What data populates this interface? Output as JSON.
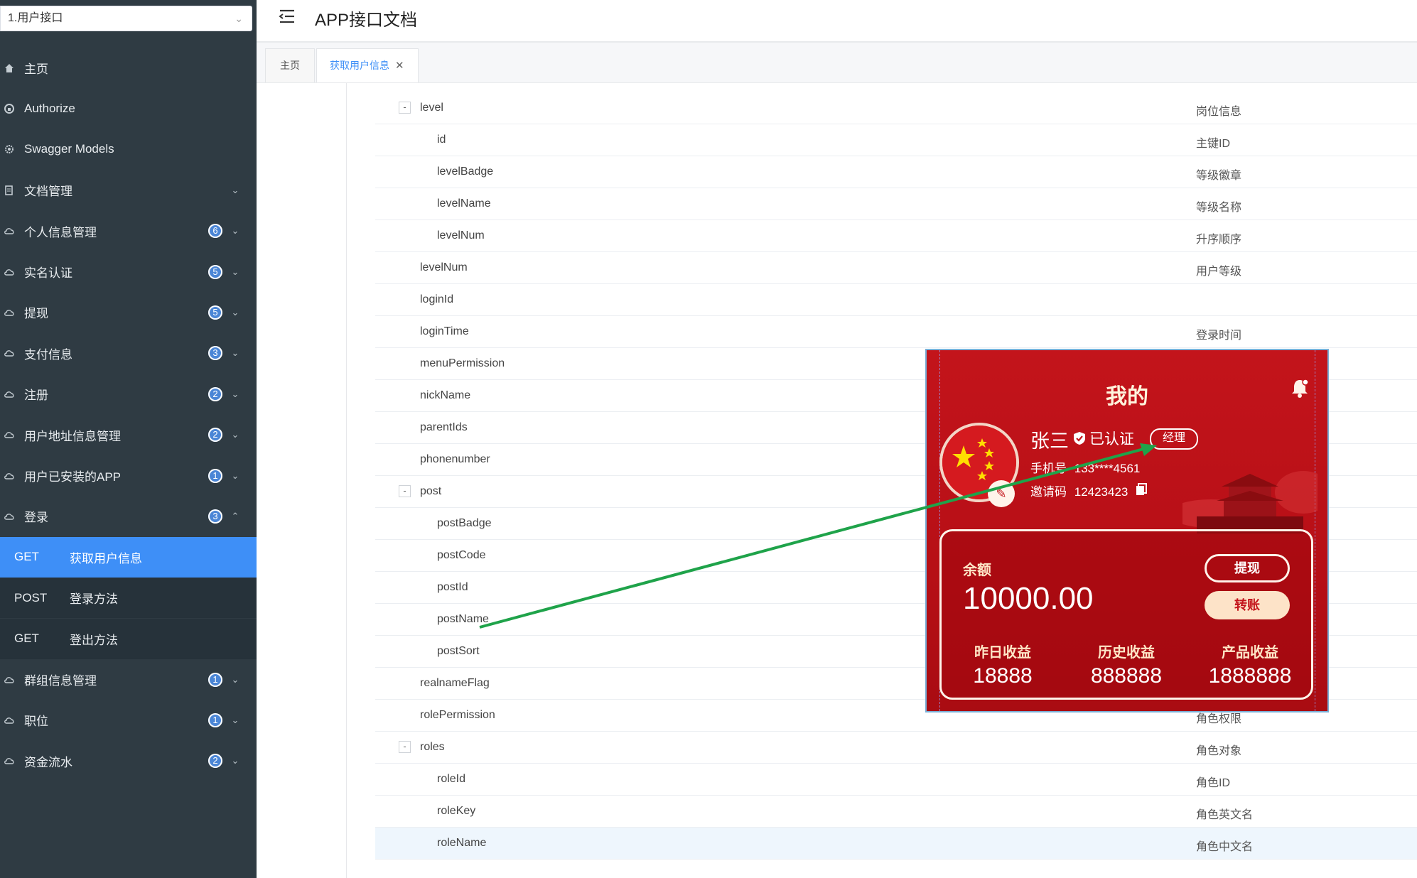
{
  "sidebar": {
    "select": "1.用户接口",
    "items": [
      {
        "label": "主页",
        "icon": "home-icon"
      },
      {
        "label": "Authorize",
        "icon": "lock-icon"
      },
      {
        "label": "Swagger Models",
        "icon": "gear-icon"
      },
      {
        "label": "文档管理",
        "icon": "document-icon"
      },
      {
        "label": "个人信息管理",
        "icon": "cloud-icon",
        "badge": "6"
      },
      {
        "label": "实名认证",
        "icon": "cloud-icon",
        "badge": "5"
      },
      {
        "label": "提现",
        "icon": "cloud-icon",
        "badge": "5"
      },
      {
        "label": "支付信息",
        "icon": "cloud-icon",
        "badge": "3"
      },
      {
        "label": "注册",
        "icon": "cloud-icon",
        "badge": "2"
      },
      {
        "label": "用户地址信息管理",
        "icon": "cloud-icon",
        "badge": "2"
      },
      {
        "label": "用户已安装的APP",
        "icon": "cloud-icon",
        "badge": "1"
      },
      {
        "label": "登录",
        "icon": "cloud-icon",
        "badge": "3"
      }
    ],
    "sub_items": [
      {
        "method": "GET",
        "label": "获取用户信息",
        "active": true
      },
      {
        "method": "POST",
        "label": "登录方法"
      },
      {
        "method": "GET",
        "label": "登出方法"
      }
    ],
    "items_after": [
      {
        "label": "群组信息管理",
        "icon": "cloud-icon",
        "badge": "1"
      },
      {
        "label": "职位",
        "icon": "cloud-icon",
        "badge": "1"
      },
      {
        "label": "资金流水",
        "icon": "cloud-icon",
        "badge": "2"
      }
    ]
  },
  "header": {
    "title": "APP接口文档"
  },
  "tabs": [
    {
      "label": "主页"
    },
    {
      "label": "获取用户信息",
      "active": true
    }
  ],
  "rows": [
    {
      "name": "level",
      "desc": "岗位信息",
      "toggle": "-",
      "indent": 0
    },
    {
      "name": "id",
      "desc": "主键ID",
      "indent": 1
    },
    {
      "name": "levelBadge",
      "desc": "等级徽章",
      "indent": 1
    },
    {
      "name": "levelName",
      "desc": "等级名称",
      "indent": 1
    },
    {
      "name": "levelNum",
      "desc": "升序顺序",
      "indent": 1
    },
    {
      "name": "levelNum",
      "desc": "用户等级",
      "indent": 0
    },
    {
      "name": "loginId",
      "desc": "",
      "indent": 0
    },
    {
      "name": "loginTime",
      "desc": "登录时间",
      "indent": 0
    },
    {
      "name": "menuPermission",
      "desc": "",
      "indent": 0
    },
    {
      "name": "nickName",
      "desc": "",
      "indent": 0
    },
    {
      "name": "parentIds",
      "desc": "",
      "indent": 0
    },
    {
      "name": "phonenumber",
      "desc": "",
      "indent": 0
    },
    {
      "name": "post",
      "desc": "",
      "toggle": "-",
      "indent": 0
    },
    {
      "name": "postBadge",
      "desc": "",
      "indent": 1
    },
    {
      "name": "postCode",
      "desc": "",
      "indent": 1
    },
    {
      "name": "postId",
      "desc": "",
      "indent": 1
    },
    {
      "name": "postName",
      "desc": "",
      "indent": 1
    },
    {
      "name": "postSort",
      "desc": "",
      "indent": 1
    },
    {
      "name": "realnameFlag",
      "desc": "",
      "indent": 0
    },
    {
      "name": "rolePermission",
      "desc": "角色权限",
      "indent": 0
    },
    {
      "name": "roles",
      "desc": "角色对象",
      "toggle": "-",
      "indent": 0
    },
    {
      "name": "roleId",
      "desc": "角色ID",
      "indent": 1
    },
    {
      "name": "roleKey",
      "desc": "角色英文名",
      "indent": 1
    },
    {
      "name": "roleName",
      "desc": "角色中文名",
      "indent": 1,
      "highlight": true
    }
  ],
  "phone": {
    "title": "我的",
    "name": "张三",
    "verified": "已认证",
    "role": "经理",
    "phone_label": "手机号",
    "phone_value": "133****4561",
    "invite_label": "邀请码",
    "invite_value": "12423423",
    "balance_label": "余额",
    "balance": "10000.00",
    "withdraw": "提现",
    "transfer": "转账",
    "stats": [
      {
        "label": "昨日收益",
        "value": "18888"
      },
      {
        "label": "历史收益",
        "value": "888888"
      },
      {
        "label": "产品收益",
        "value": "1888888"
      }
    ]
  },
  "colors": {
    "sidebar_bg": "#2f3b43",
    "active_blue": "#3e8ff7",
    "phone_red": "#c3141b",
    "arrow_green": "#1fa34a"
  }
}
